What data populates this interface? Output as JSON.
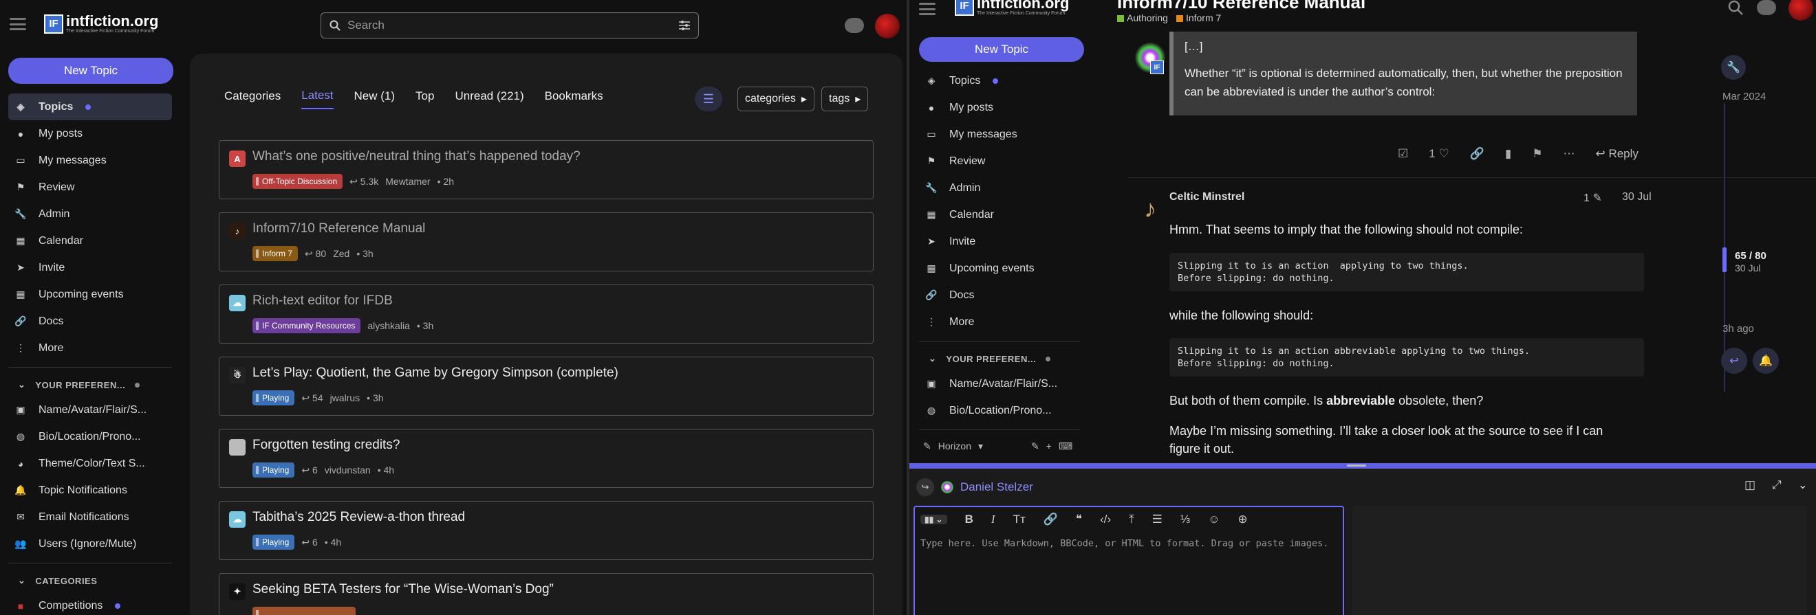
{
  "site": {
    "name": "intfiction.org",
    "tagline": "The Interactive Fiction Community Forum",
    "logo_letters": "IF"
  },
  "left": {
    "search_placeholder": "Search",
    "new_topic": "New Topic",
    "sidebar": [
      {
        "label": "Topics",
        "icon": "layers-icon",
        "active": true,
        "dot": true
      },
      {
        "label": "My posts",
        "icon": "user-icon"
      },
      {
        "label": "My messages",
        "icon": "inbox-icon"
      },
      {
        "label": "Review",
        "icon": "flag-icon"
      },
      {
        "label": "Admin",
        "icon": "wrench-icon"
      },
      {
        "label": "Calendar",
        "icon": "calendar-icon"
      },
      {
        "label": "Invite",
        "icon": "paper-plane-icon"
      },
      {
        "label": "Upcoming events",
        "icon": "calendar-icon"
      },
      {
        "label": "Docs",
        "icon": "link-icon"
      },
      {
        "label": "More",
        "icon": "ellipsis-icon"
      }
    ],
    "prefs_heading": "YOUR PREFEREN...",
    "prefs": [
      {
        "label": "Name/Avatar/Flair/S...",
        "icon": "id-card-icon"
      },
      {
        "label": "Bio/Location/Prono...",
        "icon": "globe-icon"
      },
      {
        "label": "Theme/Color/Text S...",
        "icon": "palette-icon"
      },
      {
        "label": "Topic Notifications",
        "icon": "bell-icon"
      },
      {
        "label": "Email Notifications",
        "icon": "envelope-icon"
      },
      {
        "label": "Users (Ignore/Mute)",
        "icon": "users-icon"
      }
    ],
    "categories_heading": "CATEGORIES",
    "categories": [
      {
        "label": "Competitions",
        "dot": true
      }
    ],
    "nav": [
      "Categories",
      "Latest",
      "New (1)",
      "Top",
      "Unread (221)",
      "Bookmarks"
    ],
    "nav_selected": 1,
    "drop_categories": "categories",
    "drop_tags": "tags",
    "topics": [
      {
        "title": "What’s one positive/neutral thing that’s happened today?",
        "category": "Off-Topic Discussion",
        "cat_color": "#b93c3c",
        "replies": "5.3k",
        "user": "Mewtamer",
        "age": "2h",
        "avatar_letter": "A",
        "avatar_color": "#c44",
        "read": true
      },
      {
        "title": "Inform7/10 Reference Manual",
        "category": "Inform 7",
        "cat_color": "#8a5a14",
        "replies": "80",
        "user": "Zed",
        "age": "3h",
        "avatar_letter": "♪",
        "avatar_color": "#2a1a10",
        "read": true
      },
      {
        "title": "Rich-text editor for IFDB",
        "category": "IF Community Resources",
        "cat_color": "#6c3d9c",
        "replies": "",
        "user": "alyshkalia",
        "age": "3h",
        "avatar_letter": "☁",
        "avatar_color": "#7ac6e0",
        "read": true
      },
      {
        "title": "Let’s Play: Quotient, the Game by Gregory Simpson (complete)",
        "category": "Playing",
        "cat_color": "#3b6fb6",
        "replies": "54",
        "user": "jwalrus",
        "age": "3h",
        "avatar_letter": "☃",
        "avatar_color": "#222",
        "read": false
      },
      {
        "title": "Forgotten testing credits?",
        "category": "Playing",
        "cat_color": "#3b6fb6",
        "replies": "6",
        "user": "vivdunstan",
        "age": "4h",
        "avatar_letter": "",
        "avatar_color": "#bbb",
        "read": false
      },
      {
        "title": "Tabitha’s 2025 Review-a-thon thread",
        "category": "Playing",
        "cat_color": "#3b6fb6",
        "replies": "6",
        "user": "",
        "age": "4h",
        "avatar_letter": "☁",
        "avatar_color": "#7ac6e0",
        "read": false
      },
      {
        "title": "Seeking BETA Testers for “The Wise-Woman’s Dog”",
        "category": "",
        "cat_color": "#a0522d",
        "replies": "",
        "user": "",
        "age": "",
        "avatar_letter": "✦",
        "avatar_color": "#111",
        "read": false
      }
    ]
  },
  "right": {
    "title": "Inform7/10 Reference Manual",
    "cats": [
      {
        "label": "Authoring",
        "color": "#7bbd3b"
      },
      {
        "label": "Inform 7",
        "color": "#e08a1e"
      }
    ],
    "new_topic": "New Topic",
    "sidebar": [
      {
        "label": "Topics",
        "icon": "layers-icon",
        "dot": true
      },
      {
        "label": "My posts",
        "icon": "user-icon"
      },
      {
        "label": "My messages",
        "icon": "inbox-icon"
      },
      {
        "label": "Review",
        "icon": "flag-icon"
      },
      {
        "label": "Admin",
        "icon": "wrench-icon"
      },
      {
        "label": "Calendar",
        "icon": "calendar-icon"
      },
      {
        "label": "Invite",
        "icon": "paper-plane-icon"
      },
      {
        "label": "Upcoming events",
        "icon": "calendar-icon"
      },
      {
        "label": "Docs",
        "icon": "link-icon"
      },
      {
        "label": "More",
        "icon": "ellipsis-icon"
      }
    ],
    "prefs_heading": "YOUR PREFEREN...",
    "prefs": [
      {
        "label": "Name/Avatar/Flair/S...",
        "icon": "id-card-icon"
      },
      {
        "label": "Bio/Location/Prono...",
        "icon": "globe-icon"
      }
    ],
    "theme": "Horizon",
    "quote_ellipsis": "[…]",
    "quote_text": "Whether “it” is optional is determined automatically, then, but whether the preposition can be abbreviated is under the author’s control:",
    "like_count": "1",
    "reply_label": "Reply",
    "post_author": "Celtic Minstrel",
    "edit_count": "1",
    "post_date": "30 Jul",
    "p1": "Hmm. That seems to imply that the following should not compile:",
    "code1": "Slipping it to is an action  applying to two things.\nBefore slipping: do nothing.",
    "p2": "while the following should:",
    "code2": "Slipping it to is an action abbreviable applying to two things.\nBefore slipping: do nothing.",
    "p3_a": "But both of them compile. Is ",
    "p3_b": "abbreviable",
    "p3_c": " obsolete, then?",
    "p4": "Maybe I’m missing something. I’ll take a closer look at the source to see if I can figure it out.",
    "timeline": {
      "start": "Mar 2024",
      "position": "65 / 80",
      "current_date": "30 Jul",
      "end": "3h ago"
    },
    "composer": {
      "reply_to": "Daniel Stelzer",
      "placeholder": "Type here. Use Markdown, BBCode, or HTML to format. Drag or paste images."
    }
  }
}
